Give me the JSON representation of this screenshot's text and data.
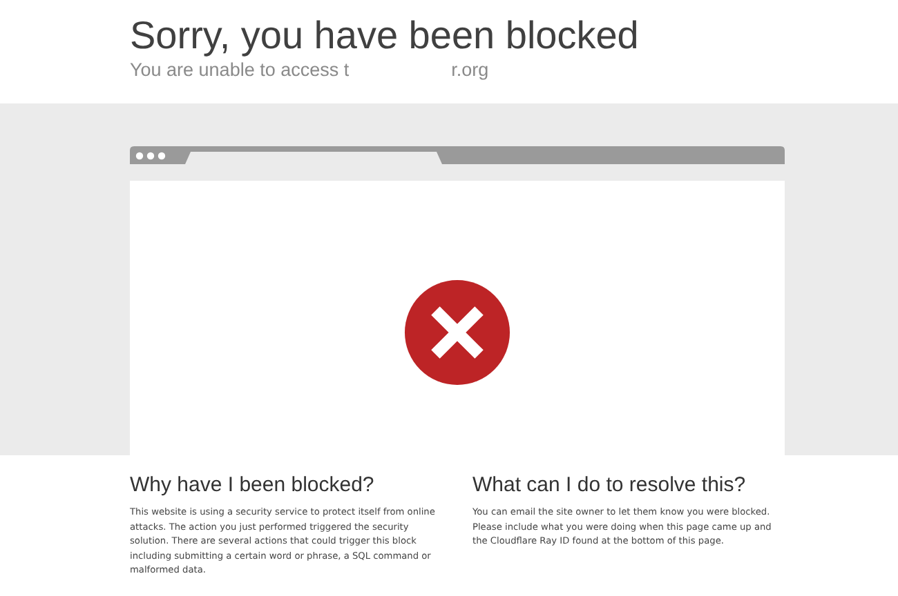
{
  "header": {
    "title": "Sorry, you have been blocked",
    "subtitle_parts": [
      "You are unable to access t",
      "r.org"
    ]
  },
  "browser": {
    "blocked": true
  },
  "sections": [
    {
      "heading": "Why have I been blocked?",
      "body": "This website is using a security service to protect itself from online attacks. The action you just performed triggered the security solution. There are several actions that could trigger this block including submitting a certain word or phrase, a SQL command or malformed data."
    },
    {
      "heading": "What can I do to resolve this?",
      "body": "You can email the site owner to let them know you were blocked. Please include what you were doing when this page came up and the Cloudflare Ray ID found at the bottom of this page."
    }
  ]
}
